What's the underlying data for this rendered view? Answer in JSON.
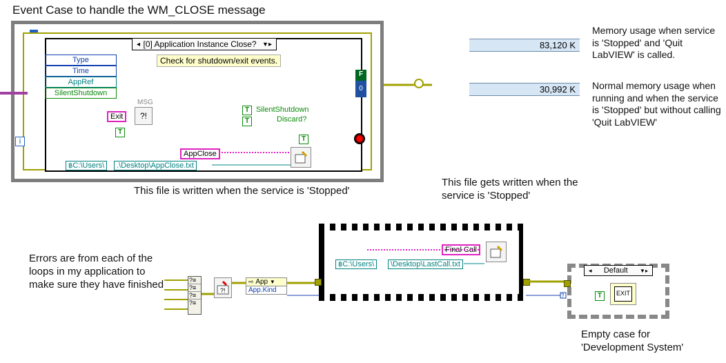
{
  "titles": {
    "main": "Event Case to handle the WM_CLOSE message"
  },
  "annotations": {
    "file_written_upper": "This file is written when the service is 'Stopped'",
    "file_written_film": "This file gets written when the service is 'Stopped'",
    "errors": "Errors are from each of the loops in my application to make sure they have finished",
    "mem_high": "Memory usage when service is 'Stopped' and 'Quit LabVIEW' is called.",
    "mem_norm": "Normal memory usage when running and when the service is 'Stopped' but without calling 'Quit LabVIEW'",
    "empty_case": "Empty case for 'Development System'"
  },
  "memory": {
    "high": "83,120 K",
    "norm": "30,992 K"
  },
  "event": {
    "selector": "[0] Application Instance Close?",
    "comment": "Check for shutdown/exit events.",
    "node_type": "Type",
    "node_time": "Time",
    "node_appref": "AppRef",
    "node_silent": "SilentShutdown",
    "exit_label": "Exit",
    "msg_label": "MSG",
    "silent_lbl": "SilentShutdown",
    "discard_lbl": "Discard?",
    "appclose_lbl": "AppClose",
    "path_left": "C:\\Users\\",
    "path_right": ".\\Desktop\\AppClose.txt",
    "while_f": "F",
    "while_0": "0"
  },
  "lower": {
    "app_label": "App",
    "appkind_label": "App.Kind",
    "final_call": "Final Call",
    "path_left": "C:\\Users\\",
    "path_right": "\\Desktop\\LastCall.txt",
    "case_label": "Default",
    "exit_icon": "EXIT"
  },
  "consts": {
    "T": "T",
    "F": "F",
    "i": "i"
  }
}
